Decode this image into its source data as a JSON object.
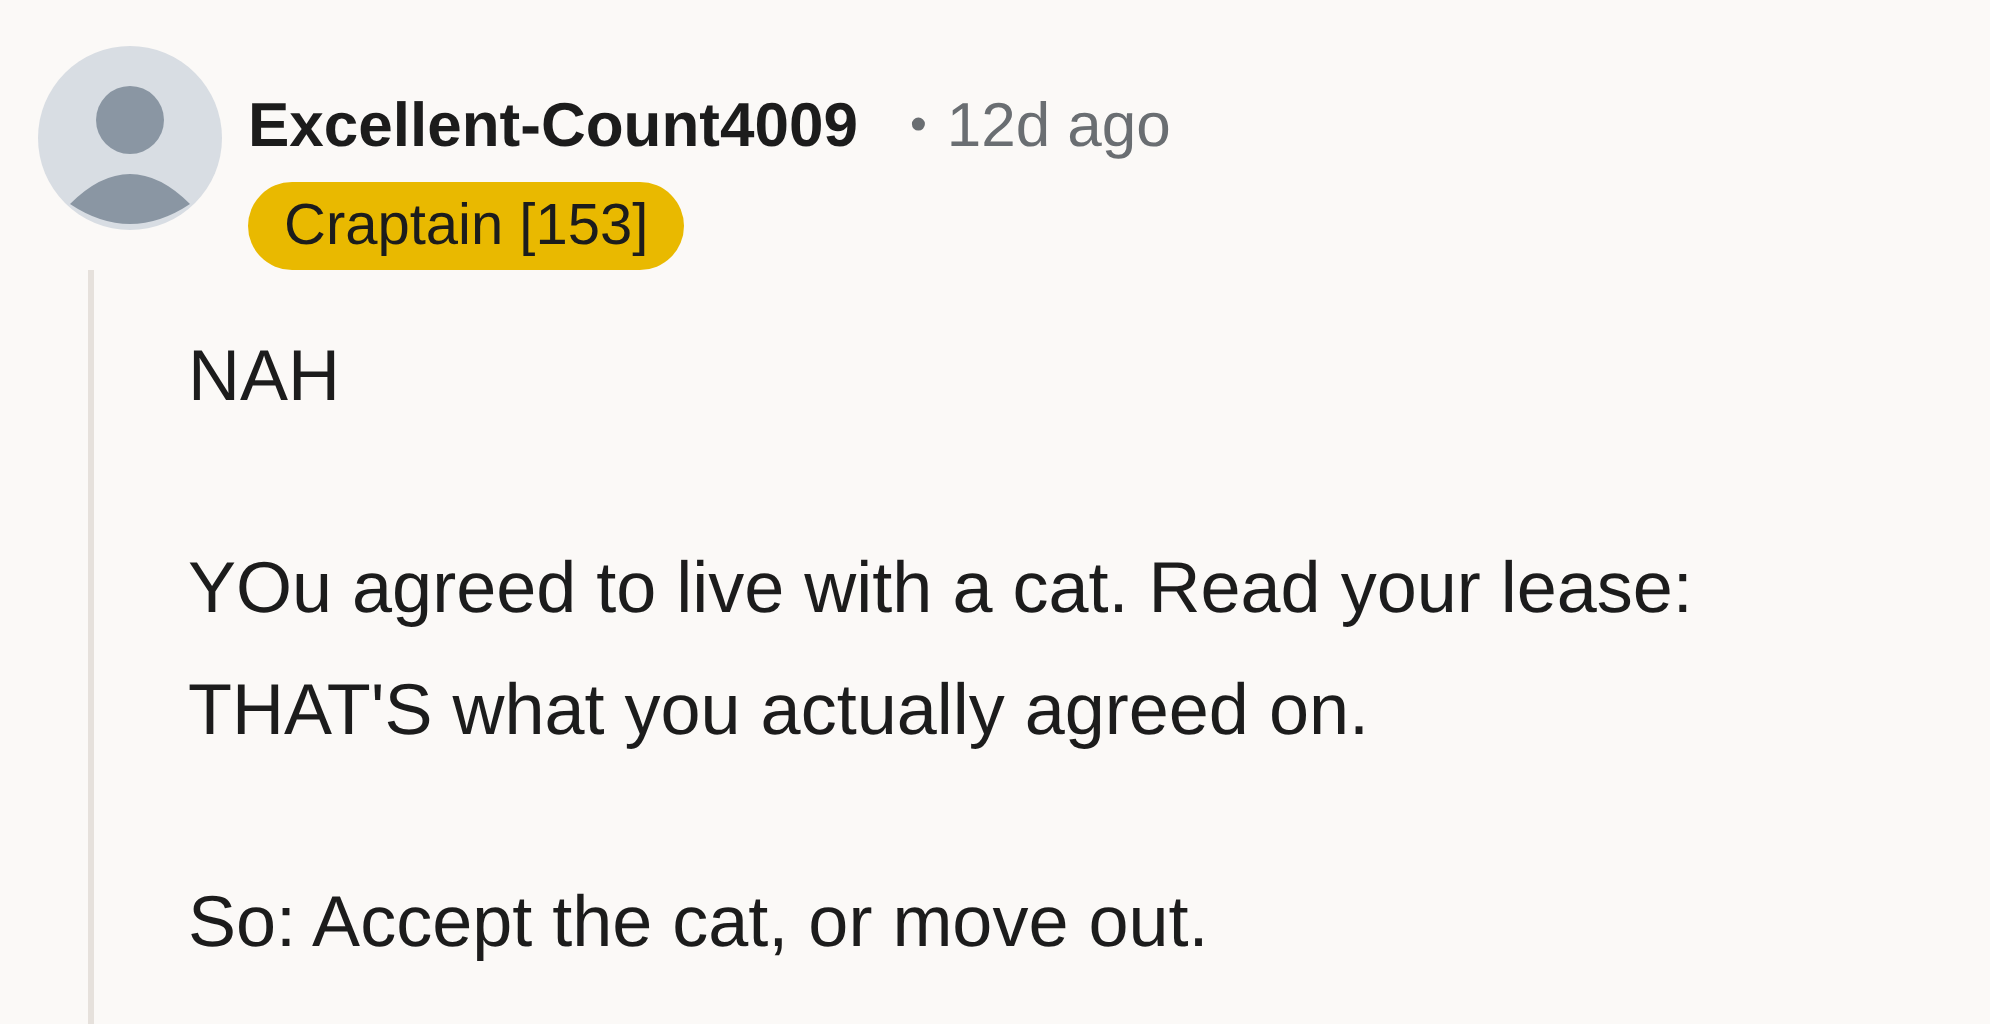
{
  "comment": {
    "author": "Excellent-Count4009",
    "separator": "•",
    "time": "12d ago",
    "flair": "Craptain [153]",
    "paragraphs": [
      [
        "NAH"
      ],
      [
        "YOu agreed to live with a cat. Read your lease:",
        "THAT'S what you actually agreed on."
      ],
      [
        "So: Accept the cat, or move out."
      ]
    ]
  }
}
